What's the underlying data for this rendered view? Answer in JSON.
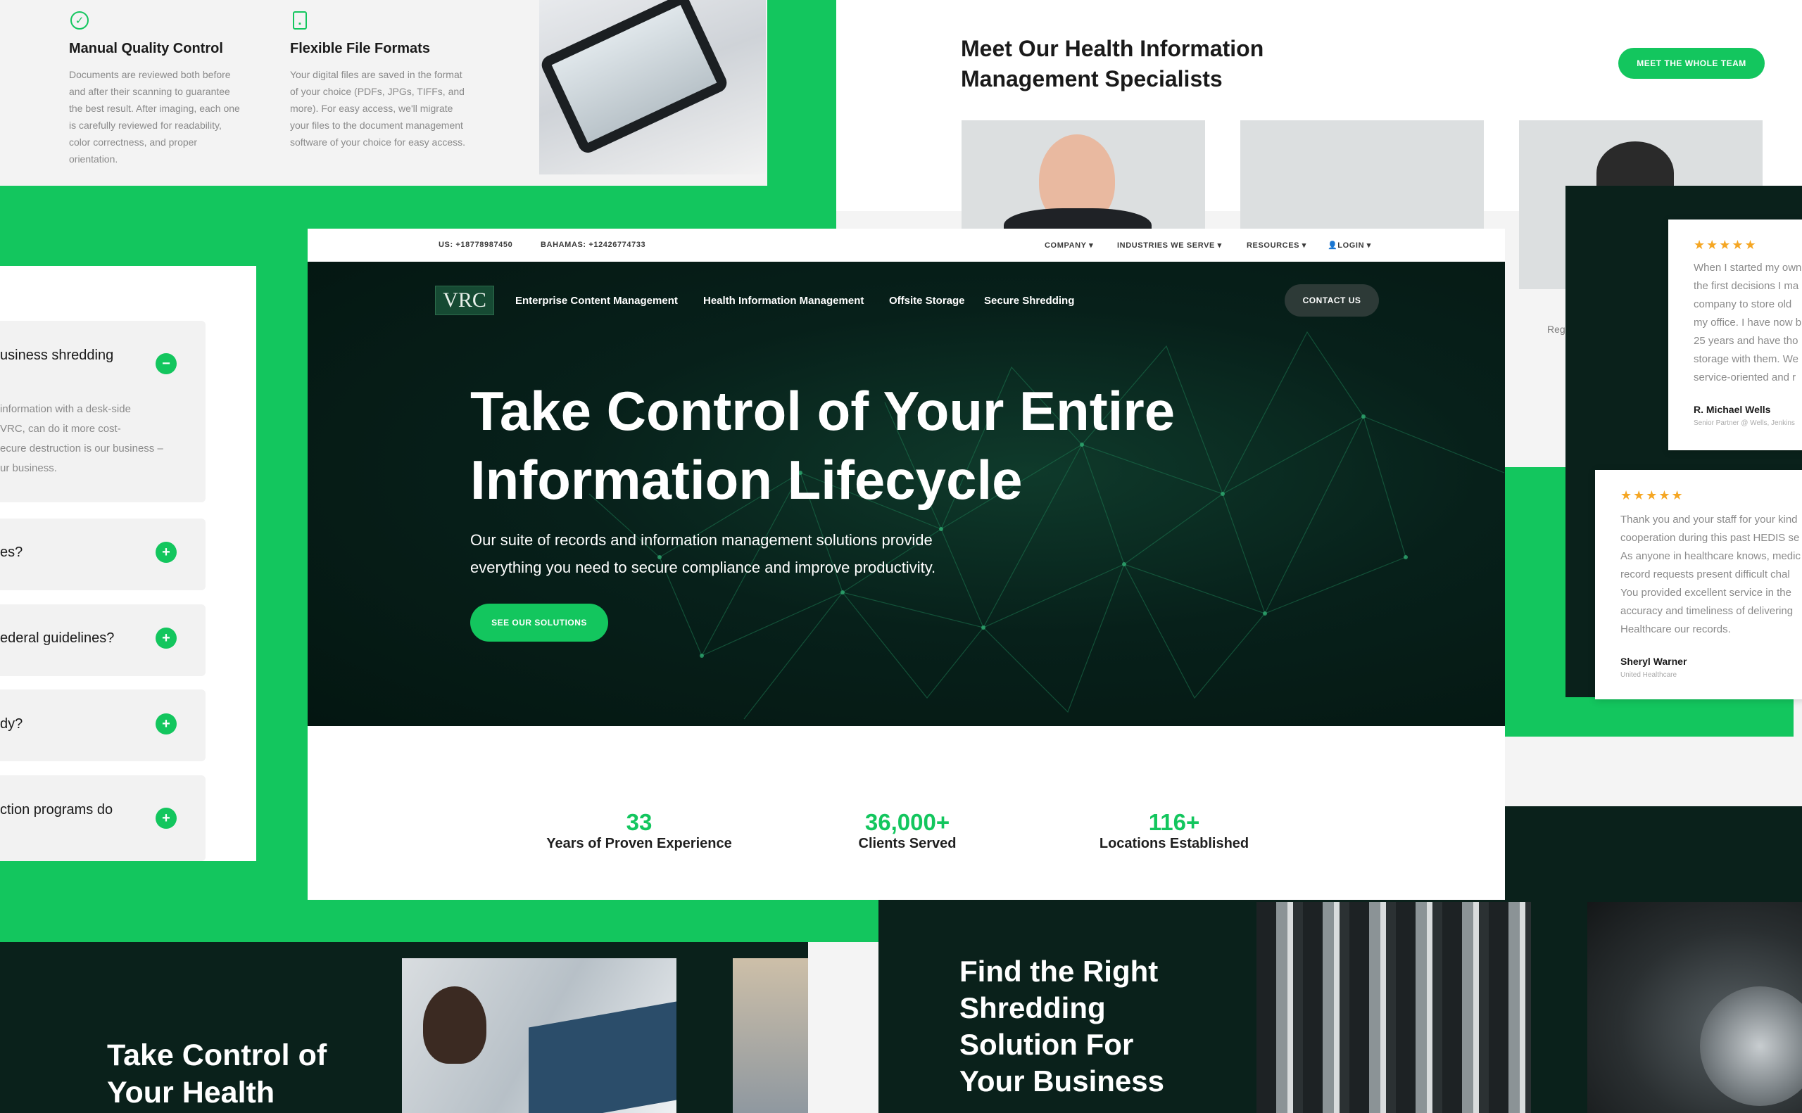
{
  "features": [
    {
      "icon": "check-circle-icon",
      "title": "Manual Quality Control",
      "body": "Documents are reviewed both before and after their scanning to guarantee the best result. After imaging, each one is carefully reviewed for readability, color correctness, and proper orientation."
    },
    {
      "icon": "file-icon",
      "title": "Flexible File Formats",
      "body": "Your digital files are saved in the format of your choice (PDFs, JPGs, TIFFs, and more). For easy access, we'll migrate your files to the document management software of your choice for easy access."
    }
  ],
  "team": {
    "title_line1": "Meet Our Health Information",
    "title_line2": "Management Specialists",
    "button": "MEET THE WHOLE TEAM",
    "partial_label": "Reg"
  },
  "faq": [
    {
      "q": "usiness shredding",
      "toggle": "−",
      "a": [
        "information with a desk-side",
        "VRC, can do it more cost-",
        "ecure destruction is our business –",
        "ur business."
      ]
    },
    {
      "q": "es?",
      "toggle": "+"
    },
    {
      "q": "ederal guidelines?",
      "toggle": "+"
    },
    {
      "q": "dy?",
      "toggle": "+"
    },
    {
      "q": "ction programs do",
      "toggle": "+"
    }
  ],
  "topbar": {
    "us": "US: +18778987450",
    "bahamas": "BAHAMAS: +12426774733",
    "menus": [
      "COMPANY",
      "INDUSTRIES WE SERVE",
      "RESOURCES",
      "LOGIN"
    ]
  },
  "nav": {
    "logo": "VRC",
    "links": [
      "Enterprise Content Management",
      "Health Information Management",
      "Offsite Storage",
      "Secure Shredding"
    ],
    "contact": "CONTACT US"
  },
  "hero": {
    "title_line1": "Take Control of Your Entire",
    "title_line2": "Information Lifecycle",
    "subtitle_line1": "Our suite of records and information management solutions provide",
    "subtitle_line2": "everything you need to secure compliance and improve productivity.",
    "cta": "SEE OUR SOLUTIONS"
  },
  "stats": [
    {
      "num": "33",
      "label": "Years of Proven Experience"
    },
    {
      "num": "36,000+",
      "label": "Clients Served"
    },
    {
      "num": "116+",
      "label": "Locations Established"
    }
  ],
  "reviews": [
    {
      "stars": "★★★★★",
      "lines": [
        "When I started my own",
        "the first decisions I ma",
        "company to store old",
        "my office. I have now b",
        "25 years and have tho",
        "storage with them. We",
        "service-oriented and r"
      ],
      "name": "R. Michael Wells",
      "role": "Senior Partner @ Wells, Jenkins"
    },
    {
      "stars": "★★★★★",
      "lines": [
        "Thank you and your staff for your kind",
        "cooperation during this past HEDIS se",
        "As anyone in healthcare knows, medic",
        "record requests present difficult chal",
        "You provided excellent service in the",
        "accuracy and timeliness of delivering",
        "Healthcare our records."
      ],
      "name": "Sheryl Warner",
      "role": "United Healthcare"
    }
  ],
  "bottom": {
    "left_line1": "Take Control of",
    "left_line2": "Your Health",
    "right_line1": "Find the Right",
    "right_line2": "Shredding",
    "right_line3": "Solution For",
    "right_line4": "Your Business"
  },
  "colors": {
    "accent": "#13c65e",
    "dark": "#0a211b"
  }
}
